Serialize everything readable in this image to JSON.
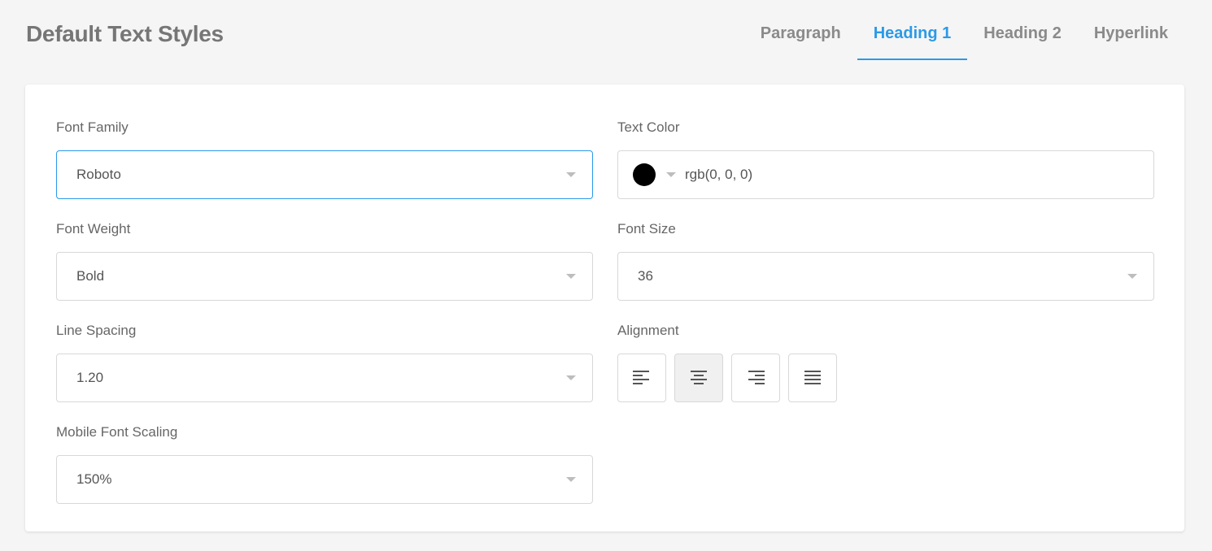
{
  "header": {
    "title": "Default Text Styles"
  },
  "tabs": [
    {
      "label": "Paragraph",
      "active": false
    },
    {
      "label": "Heading 1",
      "active": true
    },
    {
      "label": "Heading 2",
      "active": false
    },
    {
      "label": "Hyperlink",
      "active": false
    }
  ],
  "form": {
    "font_family": {
      "label": "Font Family",
      "value": "Roboto"
    },
    "text_color": {
      "label": "Text Color",
      "value": "rgb(0, 0, 0)",
      "swatch": "#000000"
    },
    "font_weight": {
      "label": "Font Weight",
      "value": "Bold"
    },
    "font_size": {
      "label": "Font Size",
      "value": "36"
    },
    "line_spacing": {
      "label": "Line Spacing",
      "value": "1.20"
    },
    "alignment": {
      "label": "Alignment",
      "options": [
        "align-left",
        "align-center",
        "align-right",
        "align-justify"
      ],
      "selected": "align-center"
    },
    "mobile_font_scaling": {
      "label": "Mobile Font Scaling",
      "value": "150%"
    }
  },
  "colors": {
    "accent": "#2a9ae8",
    "background": "#f5f5f5",
    "card": "#ffffff"
  }
}
